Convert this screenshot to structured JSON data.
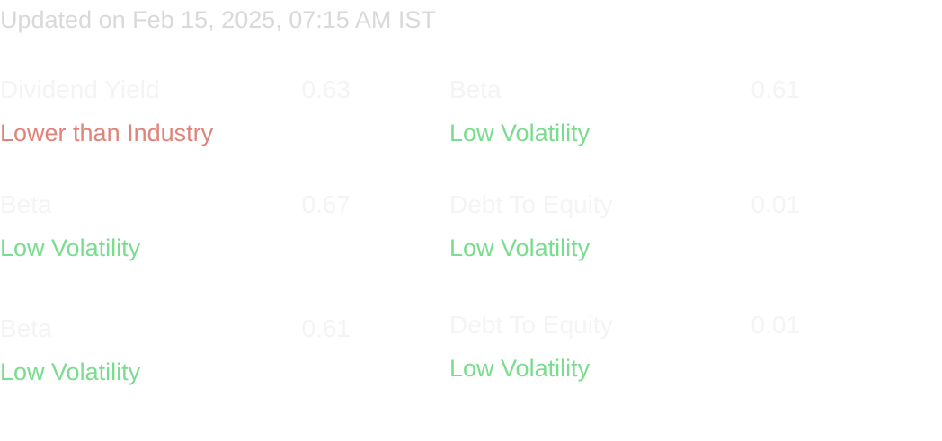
{
  "updated": "Updated on Feb 15, 2025, 07:15 AM IST",
  "metrics": [
    {
      "name": "Dividend Yield",
      "value": "0.63",
      "status": "Lower than Industry",
      "status_color": "#e0837a"
    },
    {
      "name": "Beta",
      "value": "0.61",
      "status": "Low Volatility",
      "status_color": "#79dc8e"
    },
    {
      "name": "Beta",
      "value": "0.67",
      "status": "Low Volatility",
      "status_color": "#79dc8e"
    },
    {
      "name": "Debt To Equity",
      "value": "0.01",
      "status": "Low Volatility",
      "status_color": "#79dc8e"
    },
    {
      "name": "Beta",
      "value": "0.61",
      "status": "Low Volatility",
      "status_color": "#79dc8e"
    },
    {
      "name": "Debt To Equity",
      "value": "0.01",
      "status": "Low Volatility",
      "status_color": "#79dc8e"
    }
  ]
}
